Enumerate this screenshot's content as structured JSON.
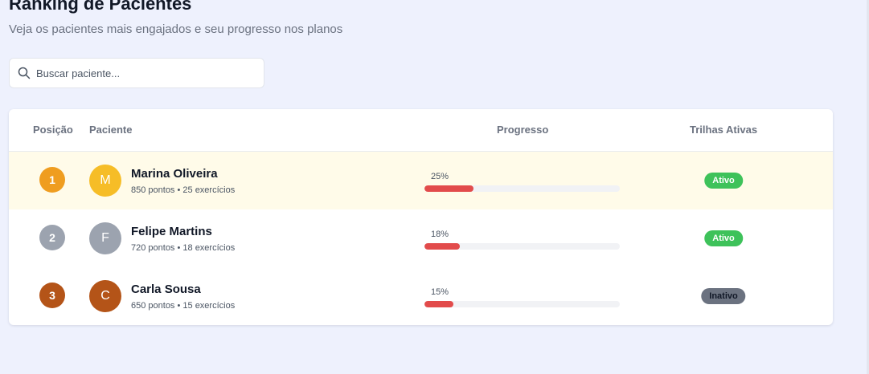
{
  "page": {
    "title": "Ranking de Pacientes",
    "subtitle": "Veja os pacientes mais engajados e seu progresso nos planos"
  },
  "search": {
    "placeholder": "Buscar paciente..."
  },
  "table": {
    "headers": {
      "position": "Posição",
      "patient": "Paciente",
      "progress": "Progresso",
      "active_tracks": "Trilhas Ativas"
    },
    "rows": [
      {
        "rank": "1",
        "rank_color": "#ef9d20",
        "avatar_initial": "M",
        "avatar_color": "#f6bd27",
        "name": "Marina Oliveira",
        "stats": "850 pontos • 25 exercícios",
        "progress_label": "25%",
        "progress": 0.25,
        "status": "Ativo",
        "status_type": "active",
        "highlight": true
      },
      {
        "rank": "2",
        "rank_color": "#9ca3af",
        "avatar_initial": "F",
        "avatar_color": "#9ca3af",
        "name": "Felipe Martins",
        "stats": "720 pontos • 18 exercícios",
        "progress_label": "18%",
        "progress": 0.18,
        "status": "Ativo",
        "status_type": "active",
        "highlight": false
      },
      {
        "rank": "3",
        "rank_color": "#b45418",
        "avatar_initial": "C",
        "avatar_color": "#b45418",
        "name": "Carla Sousa",
        "stats": "650 pontos • 15 exercícios",
        "progress_label": "15%",
        "progress": 0.15,
        "status": "Inativo",
        "status_type": "inactive",
        "highlight": false
      }
    ]
  },
  "colors": {
    "page_bg": "#eef1fd",
    "highlight_row_bg": "#fffbe9",
    "progress_fill": "#e24b4b",
    "progress_track": "#f1f2f5",
    "status_active_bg": "#3ec25a",
    "status_inactive_bg": "#6b7280"
  }
}
